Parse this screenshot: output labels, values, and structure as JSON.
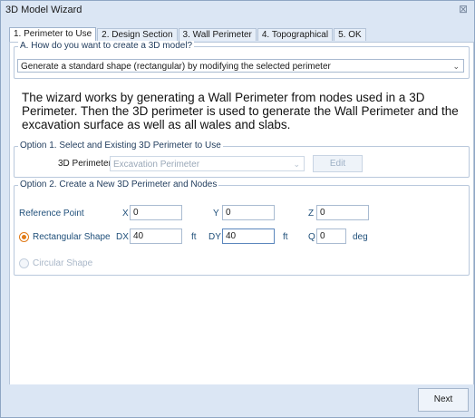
{
  "window": {
    "title": "3D Model Wizard",
    "close_glyph": "⊠"
  },
  "tabs": [
    {
      "label": "1. Perimeter to Use",
      "active": true
    },
    {
      "label": "2. Design Section",
      "active": false
    },
    {
      "label": "3. Wall Perimeter",
      "active": false
    },
    {
      "label": "4. Topographical",
      "active": false
    },
    {
      "label": "5. OK",
      "active": false
    }
  ],
  "section_a": {
    "label": "A. How do you want to create a 3D model?",
    "method_value": "Generate a standard shape (rectangular) by modifying the selected perimeter",
    "description": "The wizard works by generating a Wall Perimeter from nodes used in a 3D Perimeter. Then the 3D perimeter is used to generate the Wall Perimeter and the excavation surface as well as all wales and slabs."
  },
  "option1": {
    "label": "Option 1. Select and Existing 3D Perimeter to Use",
    "perimeter_label": "3D Perimeter",
    "perimeter_value": "Excavation Perimeter",
    "edit_label": "Edit"
  },
  "option2": {
    "label": "Option 2. Create a New 3D Perimeter and Nodes",
    "reference_point_label": "Reference Point",
    "x_label": "X",
    "x_value": "0",
    "y_label": "Y",
    "y_value": "0",
    "z_label": "Z",
    "z_value": "0",
    "rect_label": "Rectangular Shape",
    "dx_label": "DX",
    "dx_value": "40",
    "dx_unit": "ft",
    "dy_label": "DY",
    "dy_value": "40",
    "dy_unit": "ft",
    "q_label": "Q",
    "q_value": "0",
    "q_unit": "deg",
    "circular_label": "Circular Shape"
  },
  "footer": {
    "next_label": "Next"
  },
  "colors": {
    "accent": "#e07b1a",
    "frame": "#dbe6f4",
    "label_blue": "#1f4f7a"
  }
}
